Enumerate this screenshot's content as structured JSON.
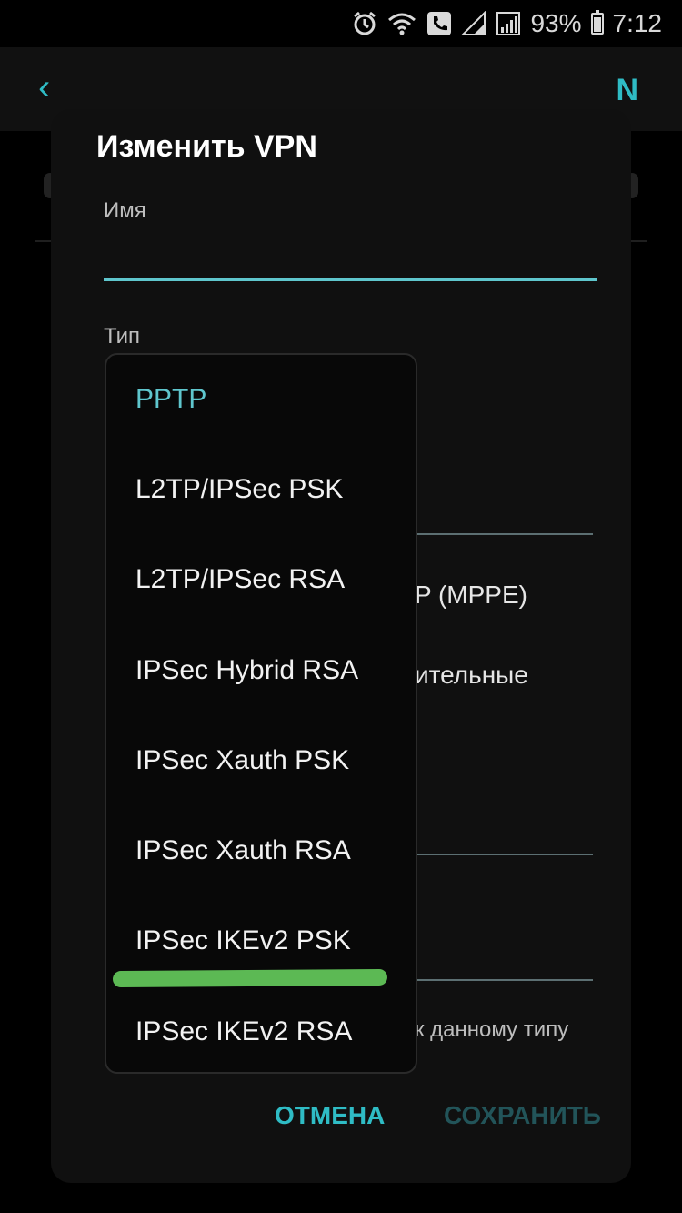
{
  "status_bar": {
    "battery": "93%",
    "time": "7:12",
    "icons": [
      "alarm-icon",
      "wifi-icon",
      "wifi-calling-icon",
      "signal-icon",
      "signal-full-icon",
      "battery-icon"
    ]
  },
  "background": {
    "back_icon": "‹",
    "appbar_right_fragment": "N",
    "fragments": {
      "mppe": "P (MPPE)",
      "additional": "ительные",
      "type_hint": "к данному типу"
    }
  },
  "dialog": {
    "title": "Изменить VPN",
    "name_label": "Имя",
    "name_value": "",
    "type_label": "Тип",
    "cancel_label": "ОТМЕНА",
    "save_label": "СОХРАНИТЬ"
  },
  "dropdown": {
    "selected_index": 0,
    "options": [
      "PPTP",
      "L2TP/IPSec PSK",
      "L2TP/IPSec RSA",
      "IPSec Hybrid RSA",
      "IPSec Xauth PSK",
      "IPSec Xauth RSA",
      "IPSec IKEv2 PSK",
      "IPSec IKEv2 RSA"
    ]
  },
  "colors": {
    "accent": "#2fbcc5",
    "selected": "#5fc6cd",
    "marker": "#5cb954"
  }
}
